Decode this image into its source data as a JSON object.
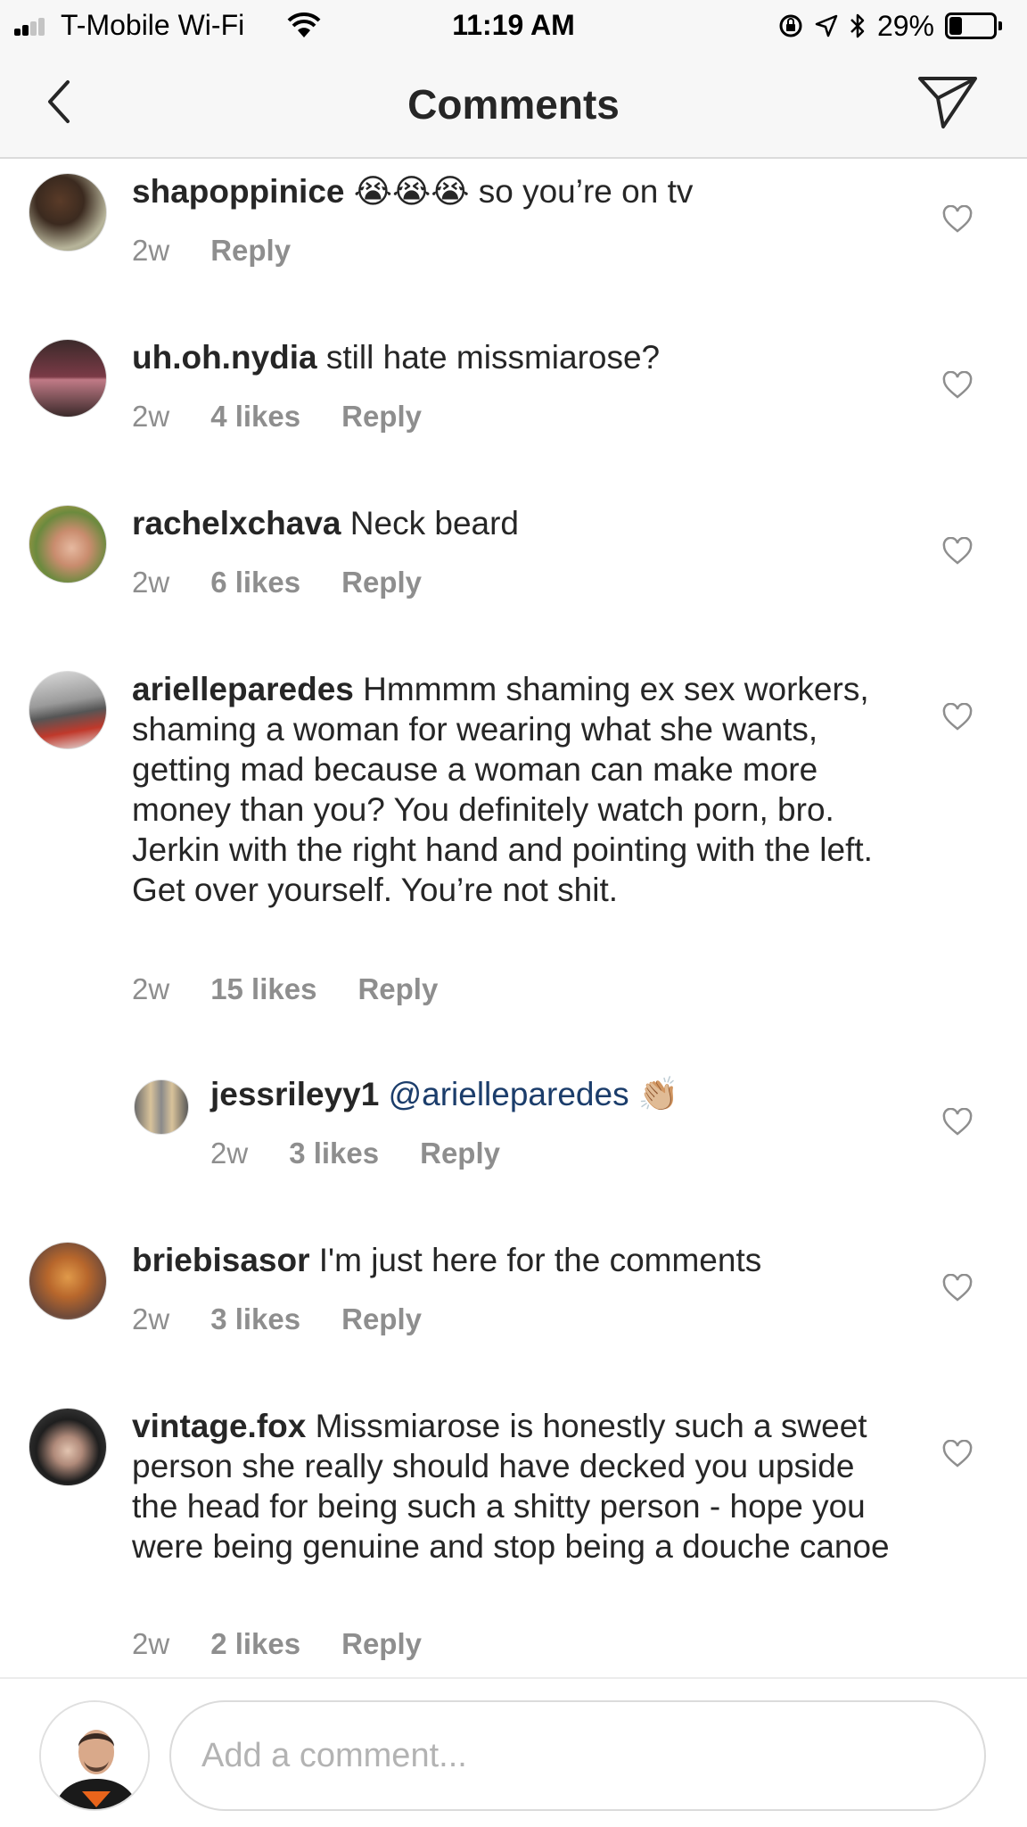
{
  "status_bar": {
    "carrier": "T-Mobile Wi-Fi",
    "time": "11:19 AM",
    "battery_percent": "29%",
    "battery_level": 0.29,
    "signal_bars_filled": 2,
    "icons": [
      "signal-icon",
      "wifi-icon",
      "orientation-lock-icon",
      "location-icon",
      "bluetooth-icon",
      "battery-icon"
    ]
  },
  "nav": {
    "title": "Comments",
    "back_icon": "chevron-left-icon",
    "share_icon": "send-icon"
  },
  "comments": [
    {
      "username": "shapoppinice",
      "emoji": "😭😭😭",
      "text": "so you’re on tv",
      "time": "2w",
      "likes": "",
      "reply": "Reply"
    },
    {
      "username": "uh.oh.nydia",
      "text": "still hate missmiarose?",
      "time": "2w",
      "likes": "4 likes",
      "reply": "Reply"
    },
    {
      "username": "rachelxchava",
      "text": "Neck beard",
      "time": "2w",
      "likes": "6 likes",
      "reply": "Reply"
    },
    {
      "username": "arielleparedes",
      "text": "Hmmmm shaming ex sex workers, shaming a woman for wearing what she wants, getting mad because a woman can make more money than you? You definitely watch porn, bro. Jerkin with the right hand and pointing with the left. Get over yourself. You’re not shit.",
      "time": "2w",
      "likes": "15 likes",
      "reply": "Reply"
    },
    {
      "username": "jessrileyy1",
      "mention": "@arielleparedes",
      "emoji": "👏🏼",
      "time": "2w",
      "likes": "3 likes",
      "reply": "Reply",
      "is_reply": true
    },
    {
      "username": "briebisasor",
      "text": "I'm just here for the comments",
      "time": "2w",
      "likes": "3 likes",
      "reply": "Reply"
    },
    {
      "username": "vintage.fox",
      "text": "Missmiarose is honestly such a sweet person she really should have decked you upside the head for being such a shitty person - hope you were being genuine and stop being a douche canoe",
      "time": "2w",
      "likes": "2 likes",
      "reply": "Reply"
    }
  ],
  "composer": {
    "placeholder": "Add a comment..."
  },
  "colors": {
    "username": "#262626",
    "meta": "#8e8e8e",
    "mention": "#1b3d6b",
    "divider": "#dbdbdb",
    "header_bg": "#f7f7f7"
  }
}
